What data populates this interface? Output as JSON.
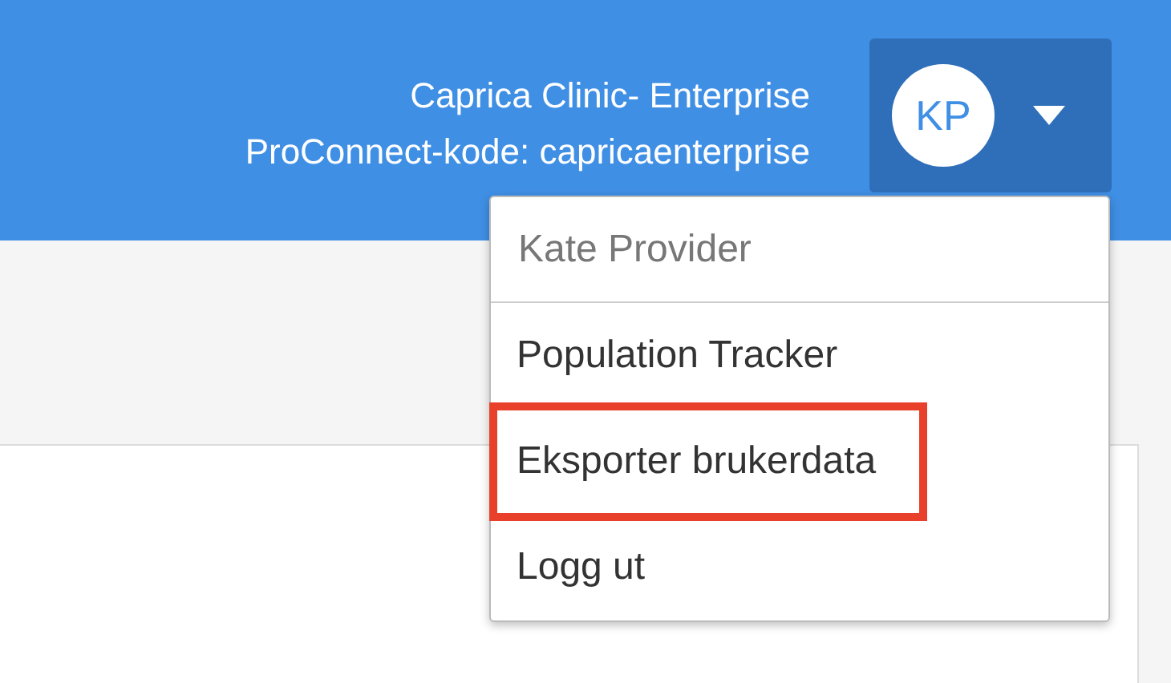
{
  "header": {
    "organization": "Caprica Clinic- Enterprise",
    "code": "ProConnect-kode: capricaenterprise"
  },
  "user": {
    "initials": "KP",
    "menu_open": true
  },
  "menu": {
    "user_name": "Kate Provider",
    "items": [
      {
        "label": "Population Tracker",
        "highlighted": false
      },
      {
        "label": "Eksporter brukerdata",
        "highlighted": true
      },
      {
        "label": "Logg ut",
        "highlighted": false
      }
    ]
  }
}
